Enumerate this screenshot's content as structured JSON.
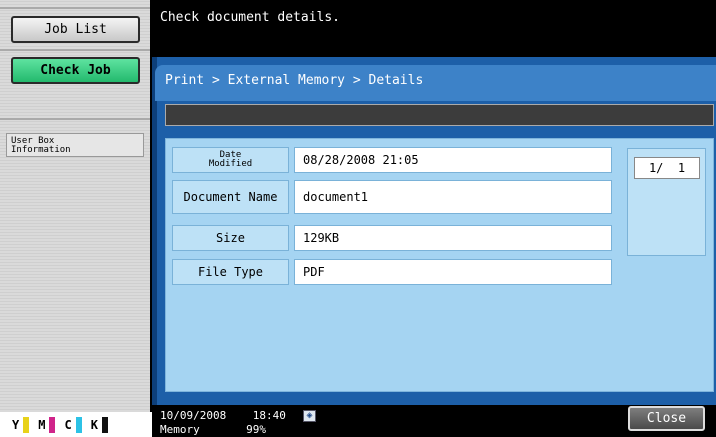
{
  "sidebar": {
    "job_list_label": "Job List",
    "check_job_label": "Check Job",
    "info_label_line1": "User Box",
    "info_label_line2": "Information"
  },
  "toner": [
    {
      "letter": "Y",
      "color": "#e8d21a"
    },
    {
      "letter": "M",
      "color": "#d0248a"
    },
    {
      "letter": "C",
      "color": "#2cc2e6"
    },
    {
      "letter": "K",
      "color": "#111111"
    }
  ],
  "message": "Check document details.",
  "breadcrumb": "Print > External Memory > Details",
  "details": {
    "date_label_line1": "Date",
    "date_label_line2": "Modified",
    "date_value": "08/28/2008 21:05",
    "name_label": "Document Name",
    "name_value": "document1",
    "size_label": "Size",
    "size_value": "129KB",
    "type_label": "File Type",
    "type_value": "PDF"
  },
  "pager": "1/  1",
  "status": {
    "datetime": "10/09/2008    18:40",
    "memory": "Memory       99%",
    "icon": "network-icon"
  },
  "close_label": "Close"
}
